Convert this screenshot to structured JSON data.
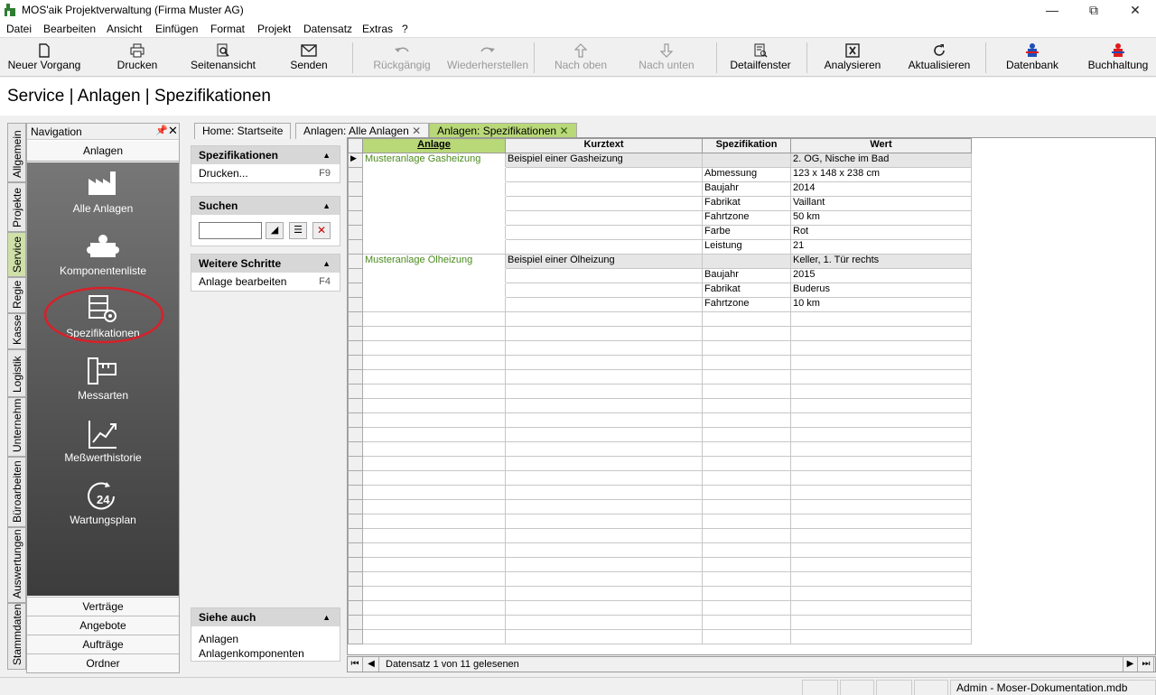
{
  "window": {
    "title": "MOS'aik Projektverwaltung (Firma Muster AG)"
  },
  "menu": [
    "Datei",
    "Bearbeiten",
    "Ansicht",
    "Einfügen",
    "Format",
    "Projekt",
    "Datensatz",
    "Extras",
    "?"
  ],
  "toolbar": {
    "new": "Neuer Vorgang",
    "print": "Drucken",
    "preview": "Seitenansicht",
    "send": "Senden",
    "undo": "Rückgängig",
    "redo": "Wiederherstellen",
    "up": "Nach oben",
    "down": "Nach unten",
    "detail": "Detailfenster",
    "analyze": "Analysieren",
    "refresh": "Aktualisieren",
    "db": "Datenbank",
    "booking": "Buchhaltung"
  },
  "page_title": "Service | Anlagen | Spezifikationen",
  "vtabs": [
    "Allgemein",
    "Projekte",
    "Service",
    "Regie",
    "Kasse",
    "Logistik",
    "Unternehmer",
    "Büroarbeiten",
    "Auswertungen",
    "Stammdaten"
  ],
  "nav": {
    "title": "Navigation",
    "section": "Anlagen",
    "items": [
      "Alle Anlagen",
      "Komponentenliste",
      "Spezifikationen",
      "Messarten",
      "Meßwerthistorie",
      "Wartungsplan"
    ],
    "bottom": [
      "Verträge",
      "Angebote",
      "Aufträge",
      "Ordner"
    ]
  },
  "task": {
    "spez": {
      "title": "Spezifikationen",
      "items": [
        {
          "label": "Drucken...",
          "key": "F9"
        }
      ]
    },
    "search": {
      "title": "Suchen",
      "value": ""
    },
    "next": {
      "title": "Weitere Schritte",
      "items": [
        {
          "label": "Anlage bearbeiten",
          "key": "F4"
        }
      ]
    },
    "see": {
      "title": "Siehe auch",
      "items": [
        "Anlagen",
        "Anlagenkomponenten"
      ]
    }
  },
  "tabs": [
    "Home: Startseite",
    "Anlagen: Alle Anlagen",
    "Anlagen: Spezifikationen"
  ],
  "grid": {
    "columns": [
      "Anlage",
      "Kurztext",
      "Spezifikation",
      "Wert"
    ],
    "rows": [
      [
        "Musteranlage Gasheizung",
        "Beispiel einer Gasheizung",
        "",
        "2. OG, Nische im Bad"
      ],
      [
        "",
        "",
        "Abmessung",
        "123 x 148 x 238 cm"
      ],
      [
        "",
        "",
        "Baujahr",
        "2014"
      ],
      [
        "",
        "",
        "Fabrikat",
        "Vaillant"
      ],
      [
        "",
        "",
        "Fahrtzone",
        "50 km"
      ],
      [
        "",
        "",
        "Farbe",
        "Rot"
      ],
      [
        "",
        "",
        "Leistung",
        "21"
      ],
      [
        "Musteranlage Ölheizung",
        "Beispiel einer Ölheizung",
        "",
        "Keller, 1. Tür rechts"
      ],
      [
        "",
        "",
        "Baujahr",
        "2015"
      ],
      [
        "",
        "",
        "Fabrikat",
        "Buderus"
      ],
      [
        "",
        "",
        "Fahrtzone",
        "10 km"
      ]
    ],
    "record_status": "Datensatz 1 von 11 gelesenen"
  },
  "status": {
    "user": "Admin - Moser-Dokumentation.mdb"
  }
}
